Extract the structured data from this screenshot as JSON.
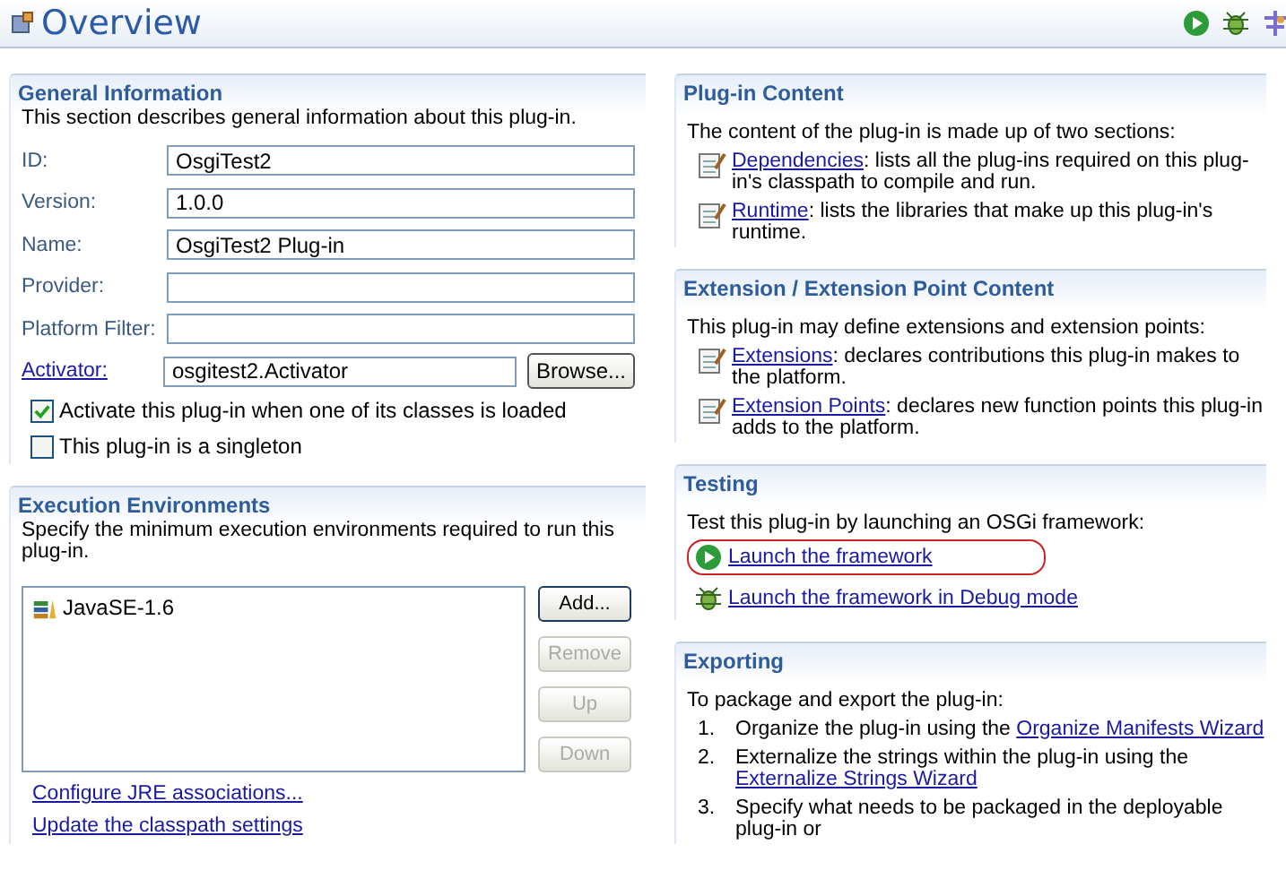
{
  "header": {
    "title": "Overview"
  },
  "general": {
    "title": "General Information",
    "description": "This section describes general information about this plug-in.",
    "fields": [
      {
        "label": "ID:",
        "value": "OsgiTest2",
        "kind": "text"
      },
      {
        "label": "Version:",
        "value": "1.0.0",
        "kind": "text"
      },
      {
        "label": "Name:",
        "value": "OsgiTest2 Plug-in",
        "kind": "text"
      },
      {
        "label": "Provider:",
        "kind": "text"
      },
      {
        "label": "Platform Filter:",
        "kind": "text"
      },
      {
        "label": "Activator:",
        "value": "osgitest2.Activator",
        "kind": "browse",
        "button": "Browse..."
      }
    ],
    "options": [
      {
        "label": "Activate this plug-in when one of its classes is loaded",
        "checked": true
      },
      {
        "label": "This plug-in is a singleton",
        "checked": false
      }
    ]
  },
  "execution": {
    "title": "Execution Environments",
    "description": "Specify the minimum execution environments required to run this plug-in.",
    "environments": [
      "JavaSE-1.6"
    ],
    "buttons": [
      {
        "label": "Add...",
        "disabled": false
      },
      {
        "label": "Remove",
        "disabled": true
      },
      {
        "label": "Up",
        "disabled": true
      },
      {
        "label": "Down",
        "disabled": true
      }
    ],
    "links": [
      "Configure JRE associations...",
      "Update the classpath settings"
    ]
  },
  "content": {
    "title": "Plug-in Content",
    "description": "The content of the plug-in is made up of two sections:",
    "items": [
      {
        "link": "Dependencies",
        "text": ": lists all the plug-ins required on this plug-in's classpath to compile and run."
      },
      {
        "link": "Runtime",
        "text": ": lists the libraries that make up this plug-in's runtime."
      }
    ]
  },
  "extension": {
    "title": "Extension / Extension Point Content",
    "description": "This plug-in may define extensions and extension points:",
    "items": [
      {
        "link": "Extensions",
        "text": ": declares contributions this plug-in makes to the platform."
      },
      {
        "link": "Extension Points",
        "text": ": declares new function points this plug-in adds to the platform."
      }
    ]
  },
  "testing": {
    "title": "Testing",
    "description": "Test this plug-in by launching an OSGi framework:",
    "links": [
      {
        "label": "Launch the framework",
        "kind": "run",
        "highlighted": true
      },
      {
        "label": "Launch the framework in Debug mode",
        "kind": "debug",
        "highlighted": false
      }
    ]
  },
  "exporting": {
    "title": "Exporting",
    "description": "To package and export the plug-in:",
    "steps": [
      {
        "number": "1.",
        "text": "Organize the plug-in using the ",
        "link": "Organize Manifests Wizard"
      },
      {
        "number": "2.",
        "text": "Externalize the strings within the plug-in using the ",
        "link": "Externalize Strings Wizard"
      },
      {
        "number": "3.",
        "text": "Specify what needs to be packaged in the deployable plug-in or"
      }
    ]
  }
}
